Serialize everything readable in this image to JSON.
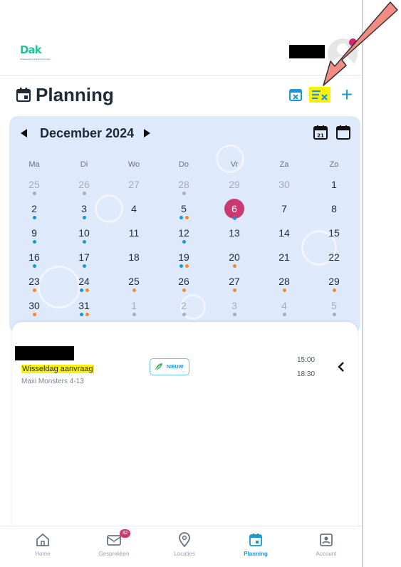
{
  "header": {
    "logo_text": "Dak",
    "logo_tagline": "Kinderopvang & Buitenschoolse"
  },
  "page": {
    "title": "Planning"
  },
  "calendar": {
    "month_label": "December 2024",
    "weekdays": [
      "Ma",
      "Di",
      "Wo",
      "Do",
      "Vr",
      "Za",
      "Zo"
    ],
    "weeks": [
      [
        {
          "day": "25",
          "muted": true,
          "dots": [
            "grey"
          ]
        },
        {
          "day": "26",
          "muted": true,
          "dots": [
            "grey"
          ]
        },
        {
          "day": "27",
          "muted": true,
          "dots": []
        },
        {
          "day": "28",
          "muted": true,
          "dots": [
            "grey"
          ]
        },
        {
          "day": "29",
          "muted": true,
          "dots": []
        },
        {
          "day": "30",
          "muted": true,
          "dots": []
        },
        {
          "day": "1",
          "muted": false,
          "dots": []
        }
      ],
      [
        {
          "day": "2",
          "muted": false,
          "dots": [
            "blue"
          ]
        },
        {
          "day": "3",
          "muted": false,
          "dots": [
            "blue"
          ]
        },
        {
          "day": "4",
          "muted": false,
          "dots": []
        },
        {
          "day": "5",
          "muted": false,
          "dots": [
            "blue",
            "orange"
          ]
        },
        {
          "day": "6",
          "muted": false,
          "today": true,
          "dots": [
            "blue"
          ]
        },
        {
          "day": "7",
          "muted": false,
          "dots": []
        },
        {
          "day": "8",
          "muted": false,
          "dots": []
        }
      ],
      [
        {
          "day": "9",
          "muted": false,
          "dots": [
            "blue"
          ]
        },
        {
          "day": "10",
          "muted": false,
          "dots": [
            "blue"
          ]
        },
        {
          "day": "11",
          "muted": false,
          "dots": []
        },
        {
          "day": "12",
          "muted": false,
          "dots": [
            "blue"
          ]
        },
        {
          "day": "13",
          "muted": false,
          "dots": []
        },
        {
          "day": "14",
          "muted": false,
          "dots": []
        },
        {
          "day": "15",
          "muted": false,
          "dots": []
        }
      ],
      [
        {
          "day": "16",
          "muted": false,
          "dots": [
            "blue"
          ]
        },
        {
          "day": "17",
          "muted": false,
          "dots": [
            "blue"
          ]
        },
        {
          "day": "18",
          "muted": false,
          "dots": []
        },
        {
          "day": "19",
          "muted": false,
          "dots": [
            "blue",
            "orange"
          ]
        },
        {
          "day": "20",
          "muted": false,
          "dots": [
            "orange"
          ]
        },
        {
          "day": "21",
          "muted": false,
          "dots": []
        },
        {
          "day": "22",
          "muted": false,
          "dots": []
        }
      ],
      [
        {
          "day": "23",
          "muted": false,
          "dots": [
            "orange"
          ]
        },
        {
          "day": "24",
          "muted": false,
          "dots": [
            "blue",
            "orange"
          ]
        },
        {
          "day": "25",
          "muted": false,
          "dots": [
            "orange"
          ]
        },
        {
          "day": "26",
          "muted": false,
          "dots": [
            "orange"
          ]
        },
        {
          "day": "27",
          "muted": false,
          "dots": [
            "orange"
          ]
        },
        {
          "day": "28",
          "muted": false,
          "dots": [
            "orange"
          ]
        },
        {
          "day": "29",
          "muted": false,
          "dots": [
            "orange"
          ]
        }
      ],
      [
        {
          "day": "30",
          "muted": false,
          "dots": [
            "orange"
          ]
        },
        {
          "day": "31",
          "muted": false,
          "dots": [
            "blue",
            "orange"
          ]
        },
        {
          "day": "1",
          "muted": true,
          "dots": [
            "grey"
          ]
        },
        {
          "day": "2",
          "muted": true,
          "dots": [
            "grey"
          ]
        },
        {
          "day": "3",
          "muted": true,
          "dots": [
            "grey"
          ]
        },
        {
          "day": "4",
          "muted": true,
          "dots": [
            "grey"
          ]
        },
        {
          "day": "5",
          "muted": true,
          "dots": [
            "grey"
          ]
        }
      ]
    ]
  },
  "event": {
    "title": "Wisseldag aanvraag",
    "subtitle": "Maxi Monsters 4-13",
    "badge": "NIEUW",
    "start_time": "15:00",
    "end_time": "18:30"
  },
  "nav": {
    "items": [
      {
        "label": "Home",
        "icon": "home-icon",
        "active": false
      },
      {
        "label": "Gesprekken",
        "icon": "messages-icon",
        "active": false,
        "badge": "32"
      },
      {
        "label": "Locaties",
        "icon": "location-pin-icon",
        "active": false
      },
      {
        "label": "Planning",
        "icon": "calendar-icon",
        "active": true
      },
      {
        "label": "Account",
        "icon": "account-icon",
        "active": false
      }
    ]
  },
  "colors": {
    "accent_blue": "#1a97d4",
    "today_pink": "#c93a72",
    "calendar_bg": "#dfe9fc",
    "dot_orange": "#f08b2c",
    "highlight_yellow": "#fff200",
    "arrow_salmon": "#f28b82"
  }
}
